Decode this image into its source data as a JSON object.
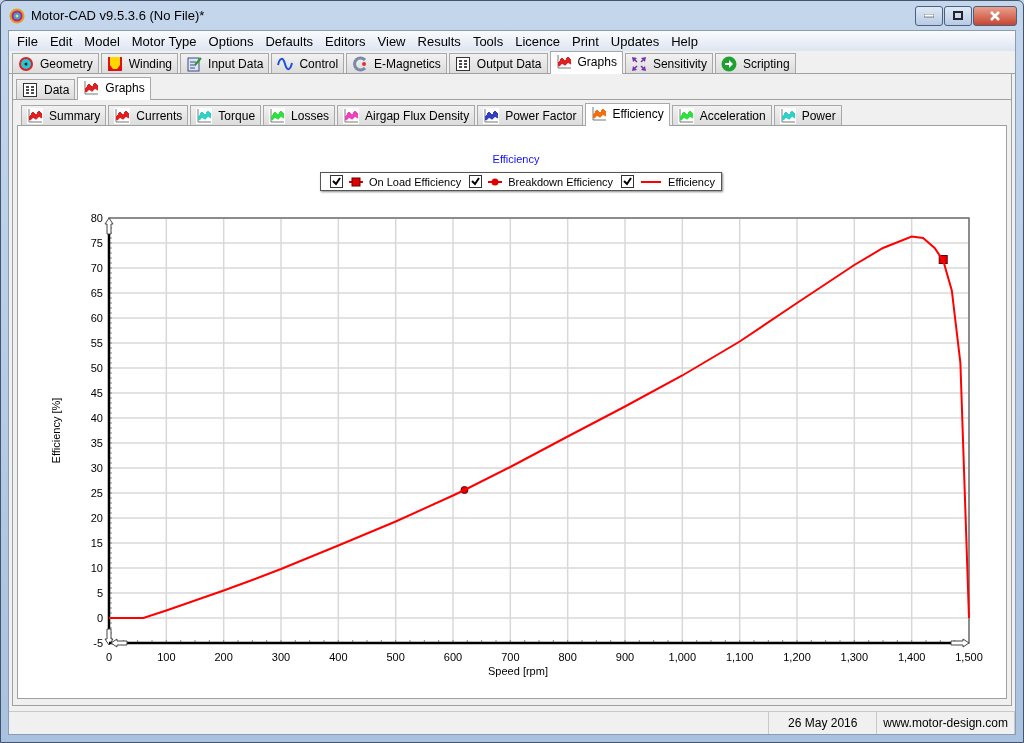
{
  "window": {
    "title": "Motor-CAD v9.5.3.6 (No File)*"
  },
  "menu": [
    "File",
    "Edit",
    "Model",
    "Motor Type",
    "Options",
    "Defaults",
    "Editors",
    "View",
    "Results",
    "Tools",
    "Licence",
    "Print",
    "Updates",
    "Help"
  ],
  "main_tabs": [
    {
      "label": "Geometry",
      "kind": "target",
      "selected": false
    },
    {
      "label": "Winding",
      "kind": "winding",
      "selected": false
    },
    {
      "label": "Input Data",
      "kind": "document",
      "selected": false
    },
    {
      "label": "Control",
      "kind": "wave",
      "selected": false
    },
    {
      "label": "E-Magnetics",
      "kind": "magnet",
      "selected": false
    },
    {
      "label": "Output Data",
      "kind": "grid",
      "selected": false
    },
    {
      "label": "Graphs",
      "kind": "graph",
      "selected": true
    },
    {
      "label": "Sensitivity",
      "kind": "arrows",
      "selected": false
    },
    {
      "label": "Scripting",
      "kind": "go",
      "selected": false
    }
  ],
  "sub_tabs": [
    {
      "label": "Data",
      "kind": "grid",
      "selected": false
    },
    {
      "label": "Graphs",
      "kind": "graph",
      "selected": true
    }
  ],
  "graph_tabs": [
    {
      "label": "Summary",
      "color": "#e02020",
      "selected": false
    },
    {
      "label": "Currents",
      "color": "#e02020",
      "selected": false
    },
    {
      "label": "Torque",
      "color": "#30d0c8",
      "selected": false
    },
    {
      "label": "Losses",
      "color": "#30e040",
      "selected": false
    },
    {
      "label": "Airgap Flux Density",
      "color": "#f040c0",
      "selected": false
    },
    {
      "label": "Power Factor",
      "color": "#3040c0",
      "selected": false
    },
    {
      "label": "Efficiency",
      "color": "#f07010",
      "selected": true
    },
    {
      "label": "Acceleration",
      "color": "#30e040",
      "selected": false
    },
    {
      "label": "Power",
      "color": "#30d0c8",
      "selected": false
    }
  ],
  "chart": {
    "legend": [
      {
        "checked": true
      },
      {
        "checked": true
      },
      {
        "checked": true
      }
    ],
    "chart_data": {
      "type": "line",
      "title": "Efficiency",
      "xlabel": "Speed [rpm]",
      "ylabel": "Efficiency [%]",
      "grid": true,
      "x": [
        0,
        60,
        100,
        200,
        250,
        300,
        400,
        500,
        600,
        620,
        700,
        800,
        900,
        1000,
        1100,
        1200,
        1300,
        1350,
        1400,
        1420,
        1440,
        1455,
        1470,
        1485,
        1500
      ],
      "series": [
        {
          "name": "On Load Efficiency",
          "color": "#e00000",
          "marker": "square",
          "values": [
            null,
            null,
            null,
            null,
            null,
            null,
            null,
            null,
            null,
            null,
            null,
            null,
            null,
            null,
            null,
            null,
            null,
            null,
            null,
            null,
            null,
            71.7,
            null,
            null,
            null
          ]
        },
        {
          "name": "Breakdown Efficiency",
          "color": "#e00000",
          "marker": "circle",
          "values": [
            null,
            null,
            null,
            null,
            null,
            null,
            null,
            null,
            null,
            25.6,
            null,
            null,
            null,
            null,
            null,
            null,
            null,
            null,
            null,
            null,
            null,
            null,
            null,
            null,
            null
          ]
        },
        {
          "name": "Efficiency",
          "color": "#ff0000",
          "marker": "none",
          "values": [
            0,
            0,
            1.5,
            5.5,
            7.6,
            9.8,
            14.5,
            19.3,
            24.5,
            25.6,
            30.2,
            36.3,
            42.3,
            48.5,
            55.3,
            63,
            70.6,
            74,
            76.3,
            76,
            74,
            71.5,
            65.5,
            51,
            0
          ]
        }
      ],
      "xlim": [
        0,
        1500
      ],
      "ylim": [
        -5,
        80
      ],
      "xticks": [
        0,
        100,
        200,
        300,
        400,
        500,
        600,
        700,
        800,
        900,
        {
          "value": 1000,
          "label": "1,000"
        },
        {
          "value": 1100,
          "label": "1,100"
        },
        {
          "value": 1200,
          "label": "1,200"
        },
        {
          "value": 1300,
          "label": "1,300"
        },
        {
          "value": 1400,
          "label": "1,400"
        },
        {
          "value": 1500,
          "label": "1,500"
        }
      ],
      "yticks": [
        -5,
        0,
        5,
        10,
        15,
        20,
        25,
        30,
        35,
        40,
        45,
        50,
        55,
        60,
        65,
        70,
        75,
        80
      ]
    }
  },
  "status_bar": {
    "date": "26 May 2016",
    "website": "www.motor-design.com"
  }
}
